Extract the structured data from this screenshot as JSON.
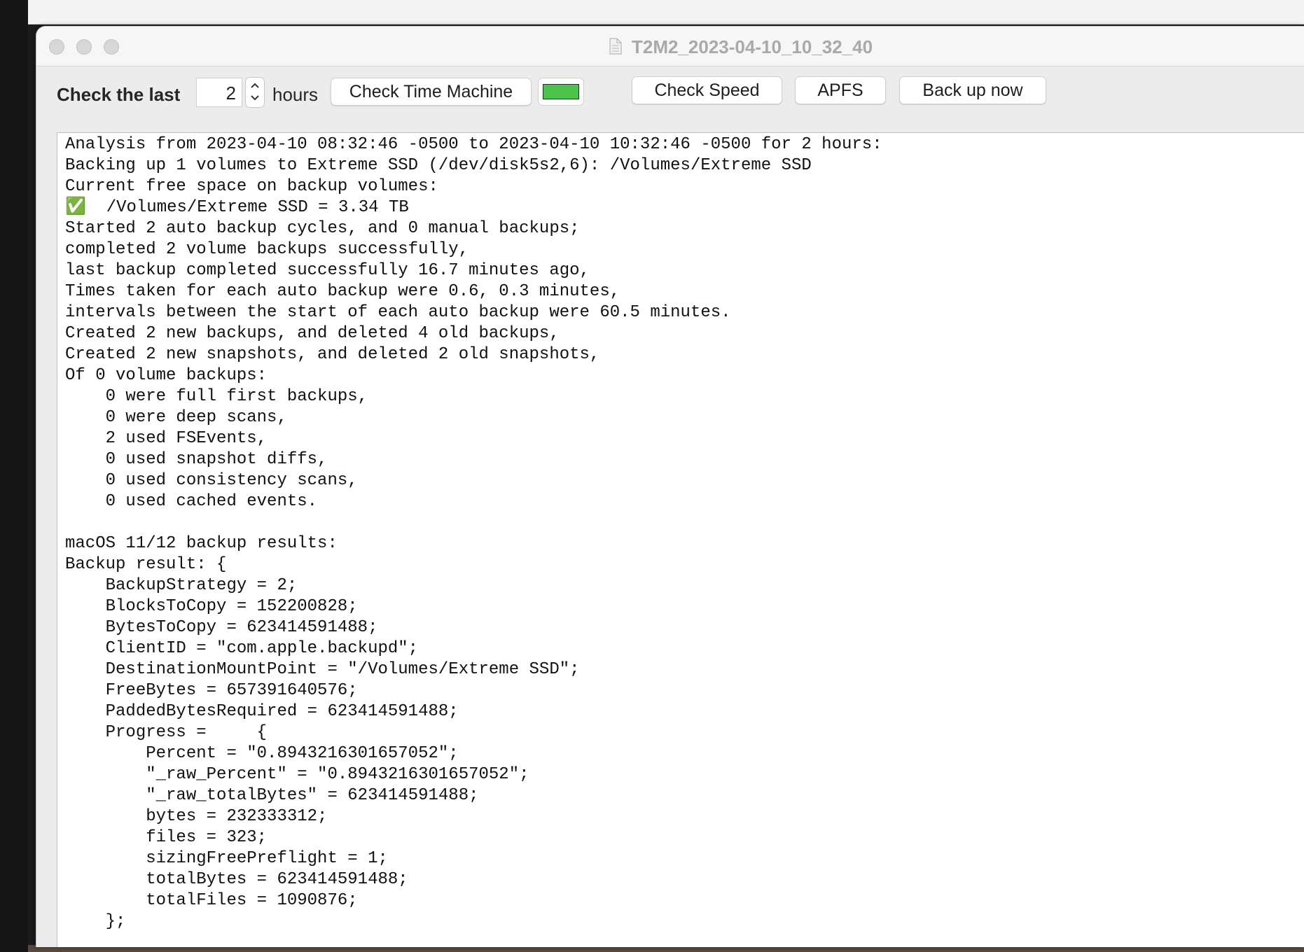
{
  "window": {
    "title": "T2M2_2023-04-10_10_32_40"
  },
  "toolbar": {
    "check_label": "Check the last",
    "hours_value": "2",
    "hours_unit": "hours",
    "check_tm_label": "Check Time Machine",
    "status_color": "#4cc44c",
    "check_speed_label": "Check Speed",
    "apfs_label": "APFS",
    "backup_now_label": "Back up now"
  },
  "icons": {
    "document": "document-icon",
    "stepper_up": "chevron-up-icon",
    "stepper_down": "chevron-down-icon"
  },
  "log": {
    "text": "Analysis from 2023-04-10 08:32:46 -0500 to 2023-04-10 10:32:46 -0500 for 2 hours:\nBacking up 1 volumes to Extreme SSD (/dev/disk5s2,6): /Volumes/Extreme SSD\nCurrent free space on backup volumes:\n✅  /Volumes/Extreme SSD = 3.34 TB\nStarted 2 auto backup cycles, and 0 manual backups;\ncompleted 2 volume backups successfully,\nlast backup completed successfully 16.7 minutes ago,\nTimes taken for each auto backup were 0.6, 0.3 minutes,\nintervals between the start of each auto backup were 60.5 minutes.\nCreated 2 new backups, and deleted 4 old backups,\nCreated 2 new snapshots, and deleted 2 old snapshots,\nOf 0 volume backups:\n    0 were full first backups,\n    0 were deep scans,\n    2 used FSEvents,\n    0 used snapshot diffs,\n    0 used consistency scans,\n    0 used cached events.\n\nmacOS 11/12 backup results:\nBackup result: {\n    BackupStrategy = 2;\n    BlocksToCopy = 152200828;\n    BytesToCopy = 623414591488;\n    ClientID = \"com.apple.backupd\";\n    DestinationMountPoint = \"/Volumes/Extreme SSD\";\n    FreeBytes = 657391640576;\n    PaddedBytesRequired = 623414591488;\n    Progress =     {\n        Percent = \"0.8943216301657052\";\n        \"_raw_Percent\" = \"0.8943216301657052\";\n        \"_raw_totalBytes\" = 623414591488;\n        bytes = 232333312;\n        files = 323;\n        sizingFreePreflight = 1;\n        totalBytes = 623414591488;\n        totalFiles = 1090876;\n    };"
  }
}
